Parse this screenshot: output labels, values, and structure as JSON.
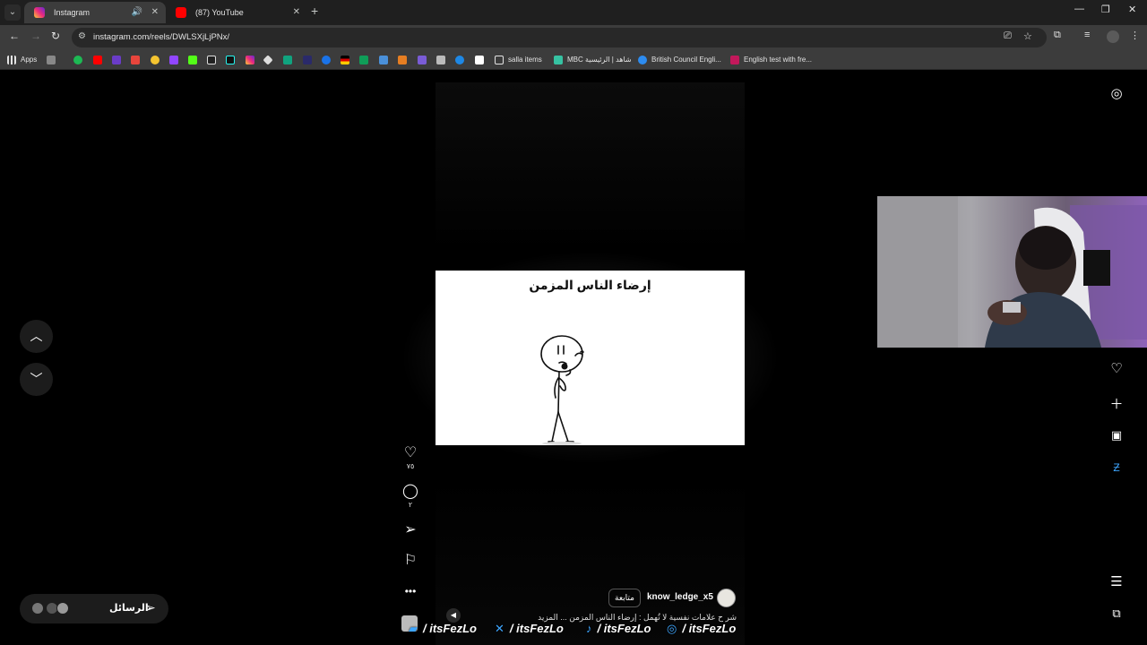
{
  "tabs": [
    {
      "title": "Instagram",
      "active": true,
      "audio": true
    },
    {
      "title": "(87) YouTube",
      "active": false
    }
  ],
  "toolbar": {
    "url": "instagram.com/reels/DWLSXjLjPNx/"
  },
  "bookmarks": {
    "apps_label": "Apps",
    "folder_label": "salla items",
    "items": [
      {
        "label": "MBC شاهد | الرئيسية"
      },
      {
        "label": "British Council Engli..."
      },
      {
        "label": "English test with fre..."
      }
    ]
  },
  "reel": {
    "video_title": "إرضاء الناس المزمن",
    "username": "know_ledge_x5",
    "follow_label": "متابعة",
    "caption": "شر ح علامات نفسية لا تُهمل : إرضاء الناس المزمن ... المزيد",
    "likes": "٧٥",
    "comments": "٢"
  },
  "messages": {
    "label": "الرسائل"
  },
  "overlay_handles": [
    {
      "platform": "twitch",
      "text": "/ itsFezLo"
    },
    {
      "platform": "x",
      "text": "/ itsFezLo"
    },
    {
      "platform": "tiktok",
      "text": "/ itsFezLo"
    },
    {
      "platform": "instagram",
      "text": "/ itsFezLo"
    }
  ],
  "colors": {
    "chrome_dark": "#1f1f1f",
    "chrome_toolbar": "#3c3c3c",
    "page_bg": "#000000",
    "youtube_red": "#ff0000"
  }
}
